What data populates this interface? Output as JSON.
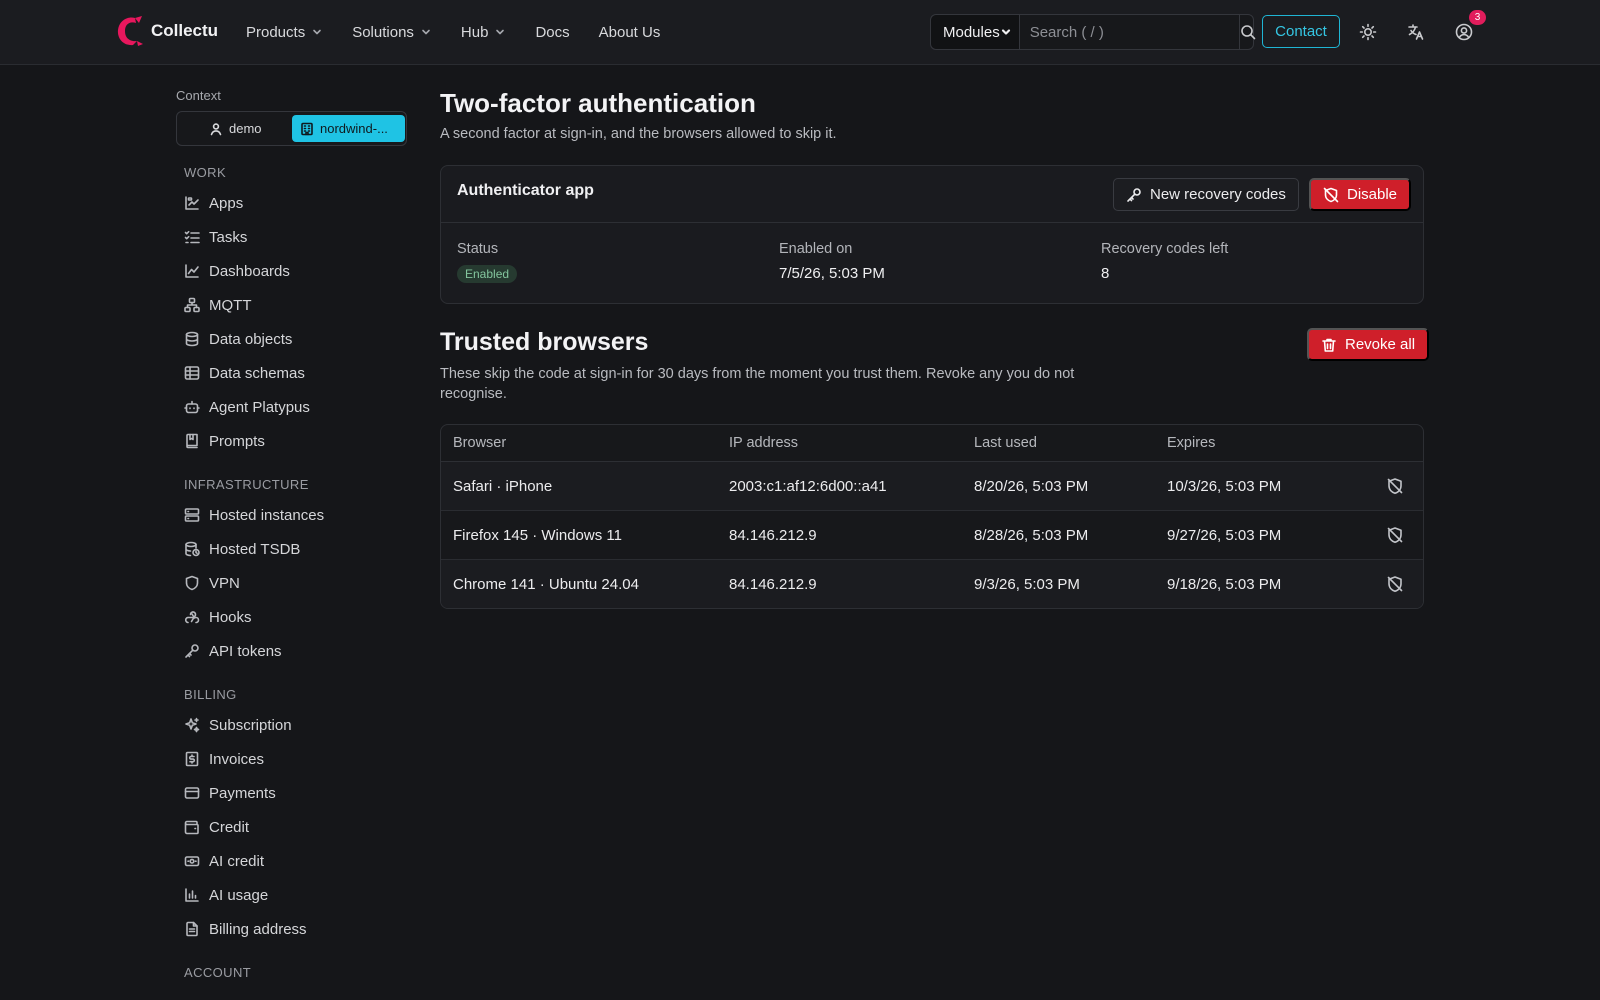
{
  "brand": {
    "name": "Collectu",
    "logo_color": "#e8175d"
  },
  "nav": {
    "items": [
      {
        "label": "Products",
        "has_menu": true
      },
      {
        "label": "Solutions",
        "has_menu": true
      },
      {
        "label": "Hub",
        "has_menu": true
      },
      {
        "label": "Docs",
        "has_menu": false
      },
      {
        "label": "About Us",
        "has_menu": false
      }
    ],
    "modules_select": "Modules",
    "search_placeholder": "Search ( / )",
    "contact_label": "Contact",
    "notification_count": "3"
  },
  "sidebar": {
    "context_label": "Context",
    "context_user": "demo",
    "context_org": "nordwind-...",
    "sections": [
      {
        "title": "WORK",
        "items": [
          {
            "label": "Apps",
            "icon": "apps-icon"
          },
          {
            "label": "Tasks",
            "icon": "tasks-icon"
          },
          {
            "label": "Dashboards",
            "icon": "dashboards-icon"
          },
          {
            "label": "MQTT",
            "icon": "mqtt-icon"
          },
          {
            "label": "Data objects",
            "icon": "database-icon"
          },
          {
            "label": "Data schemas",
            "icon": "table-icon"
          },
          {
            "label": "Agent Platypus",
            "icon": "bot-icon"
          },
          {
            "label": "Prompts",
            "icon": "book-icon"
          }
        ]
      },
      {
        "title": "INFRASTRUCTURE",
        "items": [
          {
            "label": "Hosted instances",
            "icon": "server-icon"
          },
          {
            "label": "Hosted TSDB",
            "icon": "database-clock-icon"
          },
          {
            "label": "VPN",
            "icon": "shield-icon"
          },
          {
            "label": "Hooks",
            "icon": "webhook-icon"
          },
          {
            "label": "API tokens",
            "icon": "key-icon"
          }
        ]
      },
      {
        "title": "BILLING",
        "items": [
          {
            "label": "Subscription",
            "icon": "sparkles-icon"
          },
          {
            "label": "Invoices",
            "icon": "invoice-icon"
          },
          {
            "label": "Payments",
            "icon": "credit-card-icon"
          },
          {
            "label": "Credit",
            "icon": "wallet-icon"
          },
          {
            "label": "AI credit",
            "icon": "banknote-icon"
          },
          {
            "label": "AI usage",
            "icon": "bar-chart-icon"
          },
          {
            "label": "Billing address",
            "icon": "file-icon"
          }
        ]
      },
      {
        "title": "ACCOUNT",
        "items": []
      }
    ]
  },
  "page": {
    "title": "Two-factor authentication",
    "subtitle": "A second factor at sign-in, and the browsers allowed to skip it."
  },
  "authenticator": {
    "title": "Authenticator app",
    "new_codes_label": "New recovery codes",
    "disable_label": "Disable",
    "status_label": "Status",
    "status_value": "Enabled",
    "enabled_on_label": "Enabled on",
    "enabled_on_value": "7/5/26, 5:03 PM",
    "codes_left_label": "Recovery codes left",
    "codes_left_value": "8"
  },
  "trusted": {
    "title": "Trusted browsers",
    "description": "These skip the code at sign-in for 30 days from the moment you trust them. Revoke any you do not recognise.",
    "revoke_all_label": "Revoke all",
    "columns": [
      "Browser",
      "IP address",
      "Last used",
      "Expires"
    ],
    "rows": [
      {
        "browser": "Safari · iPhone",
        "ip": "2003:c1:af12:6d00::a41",
        "last_used": "8/20/26, 5:03 PM",
        "expires": "10/3/26, 5:03 PM"
      },
      {
        "browser": "Firefox 145 · Windows 11",
        "ip": "84.146.212.9",
        "last_used": "8/28/26, 5:03 PM",
        "expires": "9/27/26, 5:03 PM"
      },
      {
        "browser": "Chrome 141 · Ubuntu 24.04",
        "ip": "84.146.212.9",
        "last_used": "9/3/26, 5:03 PM",
        "expires": "9/18/26, 5:03 PM"
      }
    ]
  },
  "colors": {
    "accent": "#1fc3e4",
    "danger": "#cf1f2a",
    "background": "#151619",
    "success_badge": "#83c59d"
  }
}
